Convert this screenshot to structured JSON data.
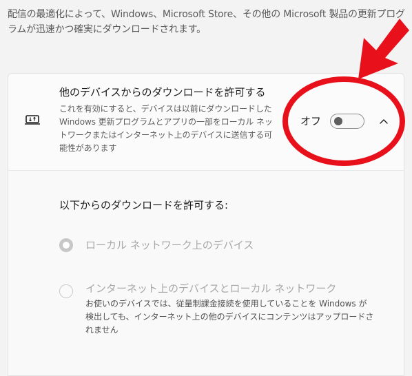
{
  "intro": {
    "text": "配信の最適化によって、Windows、Microsoft Store、その他の Microsoft 製品の更新プログラムが迅速かつ確実にダウンロードされます。"
  },
  "setting": {
    "title": "他のデバイスからのダウンロードを許可する",
    "description": "これを有効にすると、デバイスは以前にダウンロードした Windows 更新プログラムとアプリの一部をローカル ネットワークまたはインターネット上のデバイスに送信する可能性があります",
    "toggle_state": "オフ",
    "toggle_on": false,
    "expanded": true,
    "icon": "device-download-icon"
  },
  "options": {
    "heading": "以下からのダウンロードを許可する:",
    "items": [
      {
        "label": "ローカル ネットワーク上のデバイス",
        "selected": true,
        "enabled": false,
        "description": ""
      },
      {
        "label": "インターネット上のデバイスとローカル ネットワーク",
        "selected": false,
        "enabled": false,
        "description": "お使いのデバイスでは、従量制課金接続を使用していることを Windows が検出しても、インターネット上の他のデバイスにコンテンツはアップロードされません"
      }
    ]
  },
  "annotation": {
    "color": "#e8111b",
    "shapes": [
      "red-arrow",
      "red-ellipse"
    ]
  }
}
